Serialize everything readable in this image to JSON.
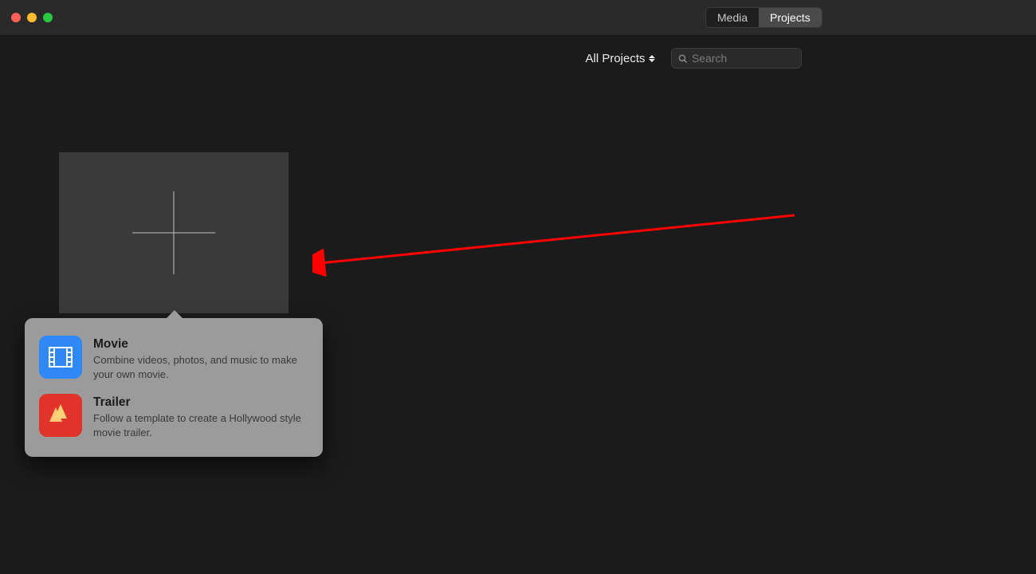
{
  "titlebar": {
    "tabs": {
      "media": "Media",
      "projects": "Projects"
    }
  },
  "toolbar": {
    "filter_label": "All Projects",
    "search_placeholder": "Search"
  },
  "new_tile": {
    "icon_name": "plus-icon"
  },
  "popover": {
    "items": [
      {
        "title": "Movie",
        "description": "Combine videos, photos, and music to make your own movie.",
        "icon_name": "film-icon"
      },
      {
        "title": "Trailer",
        "description": "Follow a template to create a Hollywood style movie trailer.",
        "icon_name": "clapper-icon"
      }
    ]
  },
  "annotation": {
    "arrow_color": "#ff0000"
  }
}
